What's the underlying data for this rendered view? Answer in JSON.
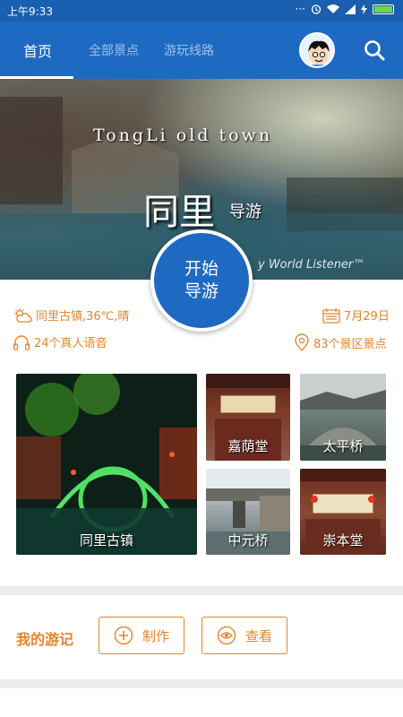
{
  "status_bar": {
    "time": "上午9:33"
  },
  "app_bar": {
    "tabs": [
      {
        "label": "首页",
        "active": true
      },
      {
        "label": "全部景点",
        "active": false
      },
      {
        "label": "游玩线路",
        "active": false
      }
    ]
  },
  "hero": {
    "title_en": "TongLi old town",
    "title_cn": "同里",
    "title_cn_small": "导游",
    "credit": "y World Listener™"
  },
  "start_button": {
    "line1": "开始",
    "line2": "导游"
  },
  "info": {
    "weather": "同里古镇,36℃,晴",
    "date": "7月29日",
    "audio": "24个真人语音",
    "spots": "83个景区景点"
  },
  "tiles": [
    {
      "label": "同里古镇"
    },
    {
      "label": "嘉荫堂"
    },
    {
      "label": "太平桥"
    },
    {
      "label": "中元桥"
    },
    {
      "label": "崇本堂"
    }
  ],
  "travelogue": {
    "title": "我的游记",
    "create_label": "制作",
    "view_label": "查看"
  },
  "colors": {
    "primary": "#1e6ac2",
    "accent": "#e8842b"
  }
}
